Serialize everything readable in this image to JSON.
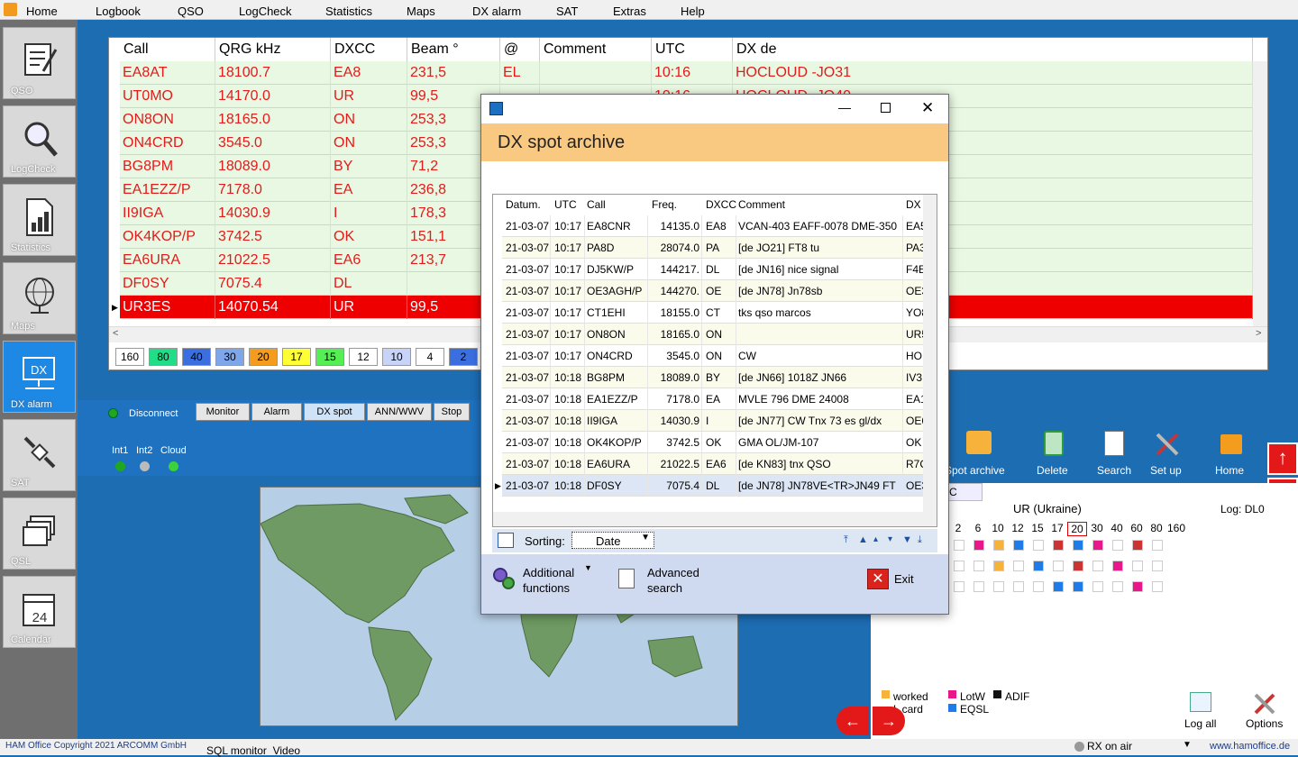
{
  "menu": [
    "Home",
    "Logbook",
    "QSO",
    "LogCheck",
    "Statistics",
    "Maps",
    "DX alarm",
    "SAT",
    "Extras",
    "Help"
  ],
  "sidebar": [
    {
      "label": "QSO",
      "icon": "qso-icon"
    },
    {
      "label": "LogCheck",
      "icon": "magnifier-icon"
    },
    {
      "label": "Statistics",
      "icon": "statistics-icon"
    },
    {
      "label": "Maps",
      "icon": "globe-icon"
    },
    {
      "label": "DX alarm",
      "icon": "dx-monitor-icon"
    },
    {
      "label": "SAT",
      "icon": "satellite-icon"
    },
    {
      "label": "QSL",
      "icon": "qsl-cards-icon"
    },
    {
      "label": "Calendar",
      "icon": "calendar-icon"
    }
  ],
  "calendar_day": "24",
  "grid": {
    "headers": [
      "Call",
      "QRG kHz",
      "DXCC",
      "Beam °",
      "@",
      "Comment",
      "UTC",
      "DX de"
    ],
    "rows": [
      [
        "EA8AT",
        "18100.7",
        "EA8",
        "231,5",
        "EL",
        "",
        "10:16",
        "HOCLOUD -JO31"
      ],
      [
        "UT0MO",
        "14170.0",
        "UR",
        "99,5",
        "",
        "",
        "10:16",
        "HOCLOUD -JO40"
      ],
      [
        "ON8ON",
        "18165.0",
        "ON",
        "253,3",
        "",
        "",
        "",
        ""
      ],
      [
        "ON4CRD",
        "3545.0",
        "ON",
        "253,3",
        "",
        "",
        "",
        ""
      ],
      [
        "BG8PM",
        "18089.0",
        "BY",
        "71,2",
        "",
        "",
        "",
        ""
      ],
      [
        "EA1EZZ/P",
        "7178.0",
        "EA",
        "236,8",
        "",
        "",
        "",
        ""
      ],
      [
        "II9IGA",
        "14030.9",
        "I",
        "178,3",
        "",
        "",
        "",
        ""
      ],
      [
        "OK4KOP/P",
        "3742.5",
        "OK",
        "151,1",
        "",
        "",
        "",
        ""
      ],
      [
        "EA6URA",
        "21022.5",
        "EA6",
        "213,7",
        "",
        "",
        "",
        ""
      ],
      [
        "DF0SY",
        "7075.4",
        "DL",
        "",
        "",
        "",
        "",
        ""
      ],
      [
        "UR3ES",
        "14070.54",
        "UR",
        "99,5",
        "",
        "",
        "",
        ""
      ]
    ]
  },
  "bands": [
    {
      "label": "160",
      "color": "#ffffff"
    },
    {
      "label": "80",
      "color": "#22dd88"
    },
    {
      "label": "40",
      "color": "#3b6fe0"
    },
    {
      "label": "30",
      "color": "#7ea6ea"
    },
    {
      "label": "20",
      "color": "#f39c1e"
    },
    {
      "label": "17",
      "color": "#ffff33"
    },
    {
      "label": "15",
      "color": "#55ee55"
    },
    {
      "label": "12",
      "color": "#ffffff"
    },
    {
      "label": "10",
      "color": "#c7d4f7"
    },
    {
      "label": "4",
      "color": "#ffffff"
    },
    {
      "label": "2",
      "color": "#3b6fe0"
    }
  ],
  "control": {
    "disconnect": "Disconnect",
    "indicators": [
      "Int1",
      "Int2",
      "Cloud"
    ],
    "tabs": [
      "Monitor",
      "Alarm",
      "DX spot",
      "ANN/WWV",
      "Stop"
    ]
  },
  "right_toolbar": [
    "Spot archive",
    "Delete",
    "Search",
    "Set up",
    "Home"
  ],
  "right_panel": {
    "tab": "C",
    "country": "UR (Ukraine)",
    "log": "Log: DL0",
    "bands": [
      "2",
      "6",
      "10",
      "12",
      "15",
      "17",
      "20",
      "30",
      "40",
      "60",
      "80",
      "160"
    ],
    "legend": {
      "worked": "worked",
      "lotw": "LotW",
      "adif": "ADIF",
      "card": "L card",
      "eqsl": "EQSL"
    },
    "log_all": "Log all",
    "options": "Options"
  },
  "status": {
    "copyright": "HAM Office Copyright 2021 ARCOMM GmbH",
    "rx": "RX on air",
    "url": "www.hamoffice.de",
    "tabs": "SQL monitor  Video"
  },
  "dialog": {
    "title": "DX spot archive",
    "headers": [
      "Datum.",
      "UTC",
      "Call",
      "Freq.",
      "DXCC",
      "Comment",
      "DX"
    ],
    "rows": [
      [
        "21-03-07",
        "10:17",
        "EA8CNR",
        "14135.0",
        "EA8",
        "VCAN-403 EAFF-0078 DME-350",
        "EA5"
      ],
      [
        "21-03-07",
        "10:17",
        "PA8D",
        "28074.0",
        "PA",
        "[de JO21] FT8 tu",
        "PA3"
      ],
      [
        "21-03-07",
        "10:17",
        "DJ5KW/P",
        "144217.",
        "DL",
        "[de JN16] nice signal",
        "F4E"
      ],
      [
        "21-03-07",
        "10:17",
        "OE3AGH/P",
        "144270.",
        "OE",
        "[de JN78] Jn78sb",
        "OE3"
      ],
      [
        "21-03-07",
        "10:17",
        "CT1EHI",
        "18155.0",
        "CT",
        "tks qso marcos",
        "YO8"
      ],
      [
        "21-03-07",
        "10:17",
        "ON8ON",
        "18165.0",
        "ON",
        "",
        "UR5"
      ],
      [
        "21-03-07",
        "10:17",
        "ON4CRD",
        "3545.0",
        "ON",
        "CW",
        "HO"
      ],
      [
        "21-03-07",
        "10:18",
        "BG8PM",
        "18089.0",
        "BY",
        "[de JN66] 1018Z JN66",
        "IV3"
      ],
      [
        "21-03-07",
        "10:18",
        "EA1EZZ/P",
        "7178.0",
        "EA",
        "MVLE 796  DME 24008",
        "EA1"
      ],
      [
        "21-03-07",
        "10:18",
        "II9IGA",
        "14030.9",
        "I",
        "[de JN77] CW Tnx 73 es gl/dx",
        "OE6"
      ],
      [
        "21-03-07",
        "10:18",
        "OK4KOP/P",
        "3742.5",
        "OK",
        "GMA OL/JM-107",
        "OK"
      ],
      [
        "21-03-07",
        "10:18",
        "EA6URA",
        "21022.5",
        "EA6",
        "[de KN83] tnx QSO",
        "R7C"
      ],
      [
        "21-03-07",
        "10:18",
        "DF0SY",
        "7075.4",
        "DL",
        "[de JN78] JN78VE<TR>JN49 FT",
        "OE3"
      ]
    ],
    "sorting_label": "Sorting:",
    "sorting_value": "Date",
    "additional": "Additional functions",
    "advanced": "Advanced search",
    "exit": "Exit"
  }
}
